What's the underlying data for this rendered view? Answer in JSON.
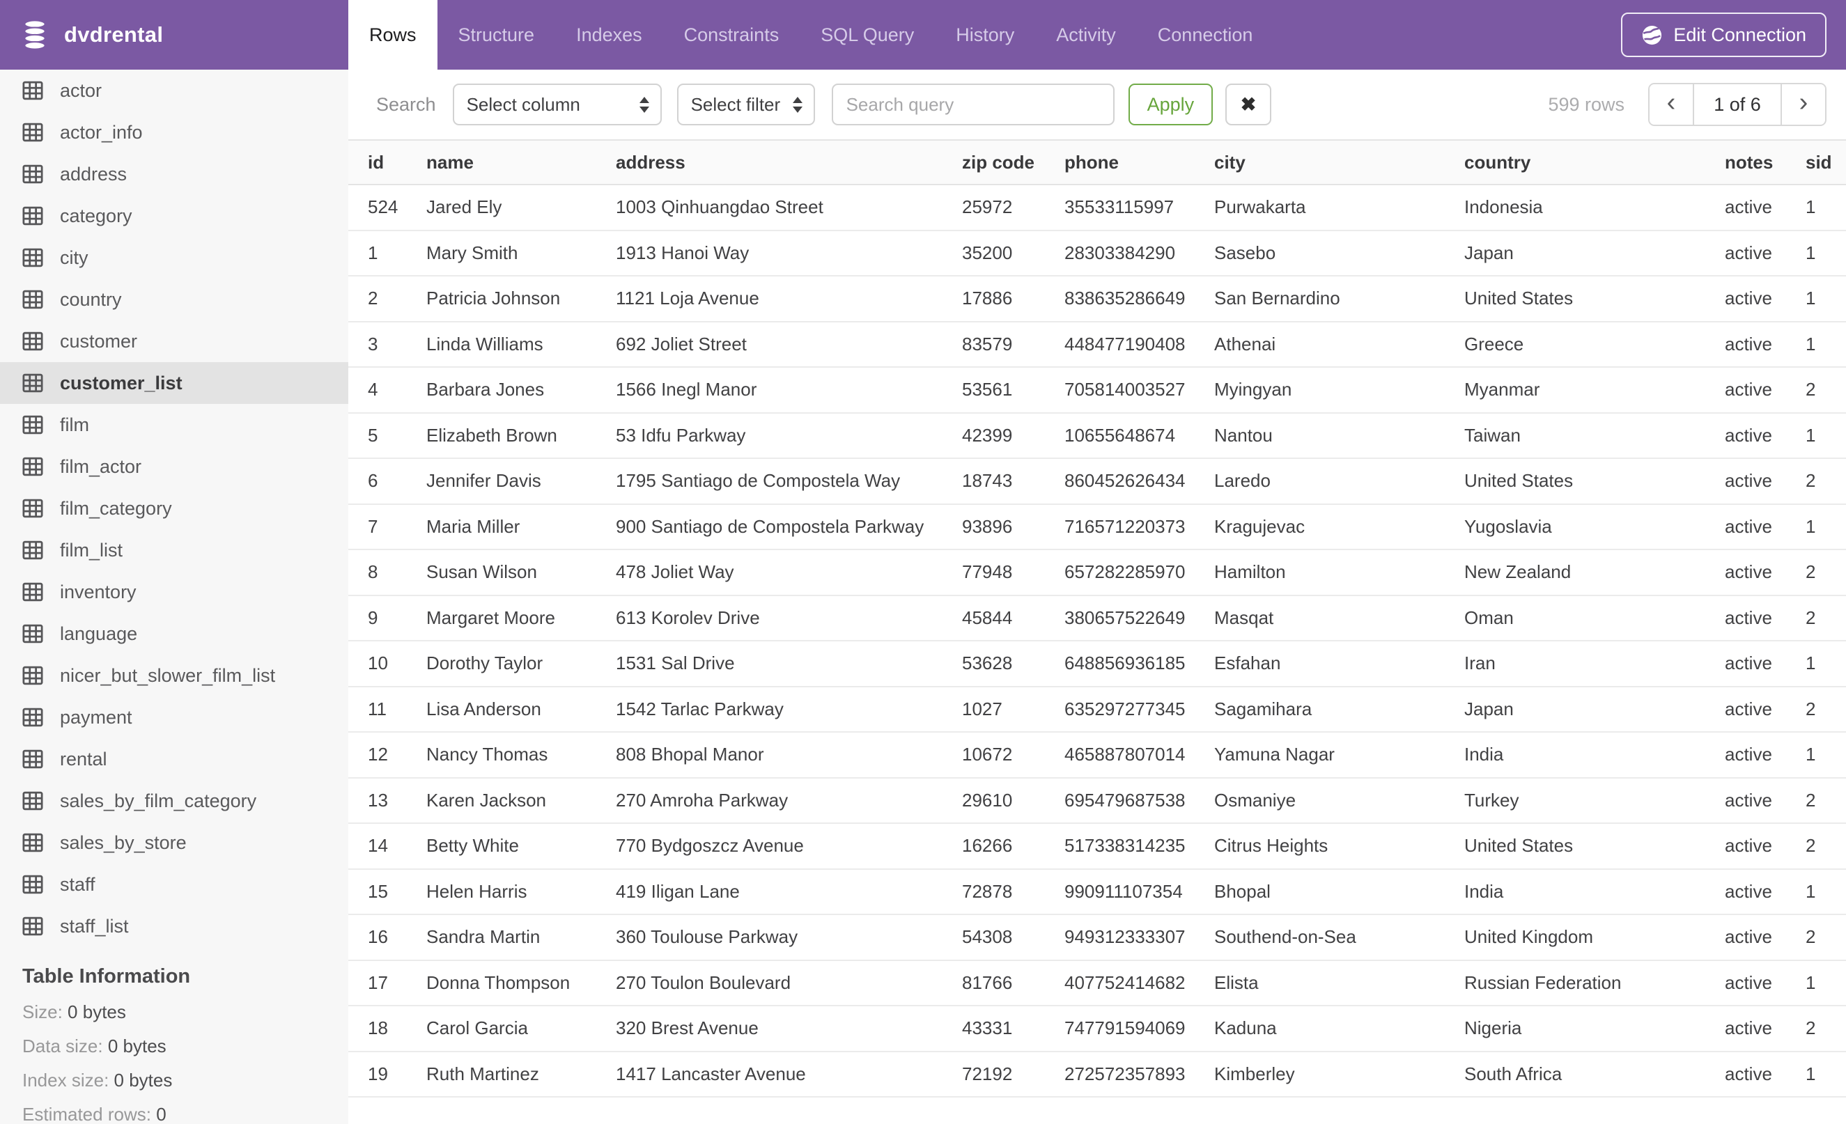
{
  "colors": {
    "accent_purple": "#7B59A3",
    "apply_green": "#67A53C",
    "sidebar_bg": "#F7F7F7",
    "active_item_bg": "#E3E3E3"
  },
  "header": {
    "app_title": "dvdrental",
    "tabs": [
      {
        "label": "Rows",
        "active": true
      },
      {
        "label": "Structure",
        "active": false
      },
      {
        "label": "Indexes",
        "active": false
      },
      {
        "label": "Constraints",
        "active": false
      },
      {
        "label": "SQL Query",
        "active": false
      },
      {
        "label": "History",
        "active": false
      },
      {
        "label": "Activity",
        "active": false
      },
      {
        "label": "Connection",
        "active": false
      }
    ],
    "edit_connection_label": "Edit Connection"
  },
  "sidebar": {
    "tables": [
      "actor",
      "actor_info",
      "address",
      "category",
      "city",
      "country",
      "customer",
      "customer_list",
      "film",
      "film_actor",
      "film_category",
      "film_list",
      "inventory",
      "language",
      "nicer_but_slower_film_list",
      "payment",
      "rental",
      "sales_by_film_category",
      "sales_by_store",
      "staff",
      "staff_list"
    ],
    "active_table": "customer_list",
    "table_information": {
      "heading": "Table Information",
      "rows": [
        {
          "label": "Size:",
          "value": "0 bytes"
        },
        {
          "label": "Data size:",
          "value": "0 bytes"
        },
        {
          "label": "Index size:",
          "value": "0 bytes"
        },
        {
          "label": "Estimated rows:",
          "value": "0"
        }
      ]
    }
  },
  "toolbar": {
    "search_label": "Search",
    "column_select_value": "Select column",
    "filter_select_value": "Select filter",
    "query_placeholder": "Search query",
    "apply_label": "Apply",
    "clear_icon": "✖",
    "rows_count": "599 rows",
    "pagination": {
      "prev_icon": "‹",
      "current": "1 of 6",
      "next_icon": "›"
    }
  },
  "table": {
    "columns": [
      "id",
      "name",
      "address",
      "zip code",
      "phone",
      "city",
      "country",
      "notes",
      "sid"
    ],
    "rows": [
      [
        "524",
        "Jared Ely",
        "1003 Qinhuangdao Street",
        "25972",
        "35533115997",
        "Purwakarta",
        "Indonesia",
        "active",
        "1"
      ],
      [
        "1",
        "Mary Smith",
        "1913 Hanoi Way",
        "35200",
        "28303384290",
        "Sasebo",
        "Japan",
        "active",
        "1"
      ],
      [
        "2",
        "Patricia Johnson",
        "1121 Loja Avenue",
        "17886",
        "838635286649",
        "San Bernardino",
        "United States",
        "active",
        "1"
      ],
      [
        "3",
        "Linda Williams",
        "692 Joliet Street",
        "83579",
        "448477190408",
        "Athenai",
        "Greece",
        "active",
        "1"
      ],
      [
        "4",
        "Barbara Jones",
        "1566 Inegl Manor",
        "53561",
        "705814003527",
        "Myingyan",
        "Myanmar",
        "active",
        "2"
      ],
      [
        "5",
        "Elizabeth Brown",
        "53 Idfu Parkway",
        "42399",
        "10655648674",
        "Nantou",
        "Taiwan",
        "active",
        "1"
      ],
      [
        "6",
        "Jennifer Davis",
        "1795 Santiago de Compostela Way",
        "18743",
        "860452626434",
        "Laredo",
        "United States",
        "active",
        "2"
      ],
      [
        "7",
        "Maria Miller",
        "900 Santiago de Compostela Parkway",
        "93896",
        "716571220373",
        "Kragujevac",
        "Yugoslavia",
        "active",
        "1"
      ],
      [
        "8",
        "Susan Wilson",
        "478 Joliet Way",
        "77948",
        "657282285970",
        "Hamilton",
        "New Zealand",
        "active",
        "2"
      ],
      [
        "9",
        "Margaret Moore",
        "613 Korolev Drive",
        "45844",
        "380657522649",
        "Masqat",
        "Oman",
        "active",
        "2"
      ],
      [
        "10",
        "Dorothy Taylor",
        "1531 Sal Drive",
        "53628",
        "648856936185",
        "Esfahan",
        "Iran",
        "active",
        "1"
      ],
      [
        "11",
        "Lisa Anderson",
        "1542 Tarlac Parkway",
        "1027",
        "635297277345",
        "Sagamihara",
        "Japan",
        "active",
        "2"
      ],
      [
        "12",
        "Nancy Thomas",
        "808 Bhopal Manor",
        "10672",
        "465887807014",
        "Yamuna Nagar",
        "India",
        "active",
        "1"
      ],
      [
        "13",
        "Karen Jackson",
        "270 Amroha Parkway",
        "29610",
        "695479687538",
        "Osmaniye",
        "Turkey",
        "active",
        "2"
      ],
      [
        "14",
        "Betty White",
        "770 Bydgoszcz Avenue",
        "16266",
        "517338314235",
        "Citrus Heights",
        "United States",
        "active",
        "2"
      ],
      [
        "15",
        "Helen Harris",
        "419 Iligan Lane",
        "72878",
        "990911107354",
        "Bhopal",
        "India",
        "active",
        "1"
      ],
      [
        "16",
        "Sandra Martin",
        "360 Toulouse Parkway",
        "54308",
        "949312333307",
        "Southend-on-Sea",
        "United Kingdom",
        "active",
        "2"
      ],
      [
        "17",
        "Donna Thompson",
        "270 Toulon Boulevard",
        "81766",
        "407752414682",
        "Elista",
        "Russian Federation",
        "active",
        "1"
      ],
      [
        "18",
        "Carol Garcia",
        "320 Brest Avenue",
        "43331",
        "747791594069",
        "Kaduna",
        "Nigeria",
        "active",
        "2"
      ],
      [
        "19",
        "Ruth Martinez",
        "1417 Lancaster Avenue",
        "72192",
        "272572357893",
        "Kimberley",
        "South Africa",
        "active",
        "1"
      ]
    ]
  }
}
